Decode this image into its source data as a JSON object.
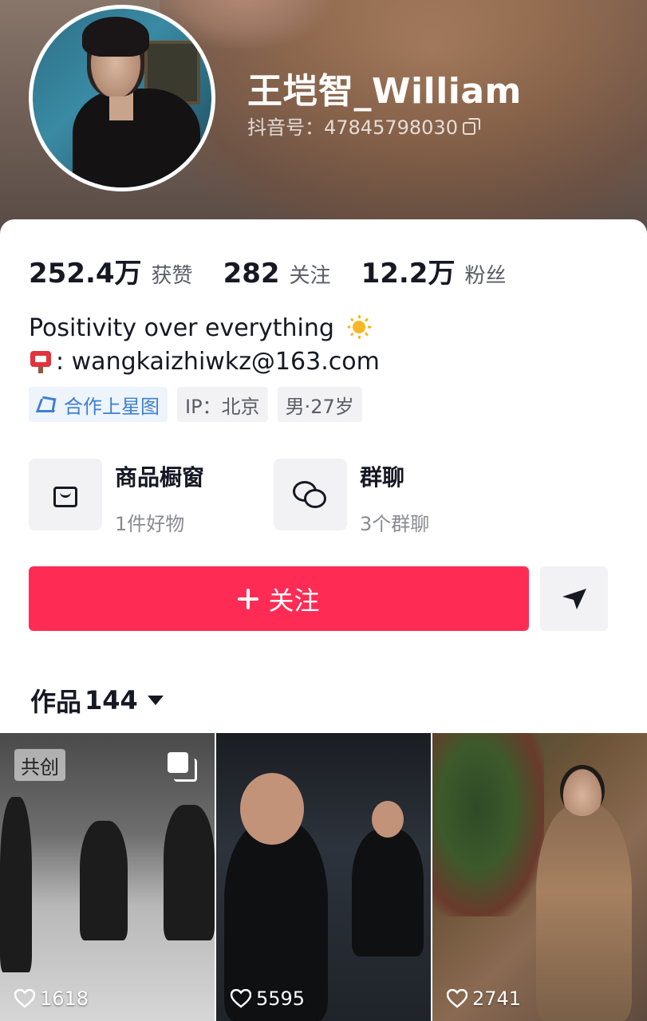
{
  "profile": {
    "display_name": "王垲智_William",
    "douyin_id": "抖音号：47845798030"
  },
  "stats": [
    {
      "value": "252.4万",
      "label": "获赞"
    },
    {
      "value": "282",
      "label": "关注"
    },
    {
      "value": "12.2万",
      "label": "粉丝"
    }
  ],
  "bio": {
    "line1": "Positivity over everything",
    "line2": ": wangkaizhiwkz@163.com"
  },
  "tags": [
    {
      "label": "合作上星图",
      "icon": "star-chart-icon"
    },
    {
      "label": "IP：北京"
    },
    {
      "label": "男·27岁"
    }
  ],
  "features": [
    {
      "title": "商品橱窗",
      "subtitle": "1件好物",
      "icon": "shopping-bag-icon"
    },
    {
      "title": "群聊",
      "subtitle": "3个群聊",
      "icon": "chat-bubbles-icon"
    }
  ],
  "actions": {
    "follow_label": "关注",
    "share_icon": "paper-plane-icon"
  },
  "works": {
    "label": "作品",
    "count": "144"
  },
  "videos": [
    {
      "likes": "1618",
      "badge": "共创",
      "multi": true
    },
    {
      "likes": "5595"
    },
    {
      "likes": "2741"
    }
  ],
  "colors": {
    "follow_button": "#fe2c55",
    "star_tag": "#3f7fd0"
  }
}
